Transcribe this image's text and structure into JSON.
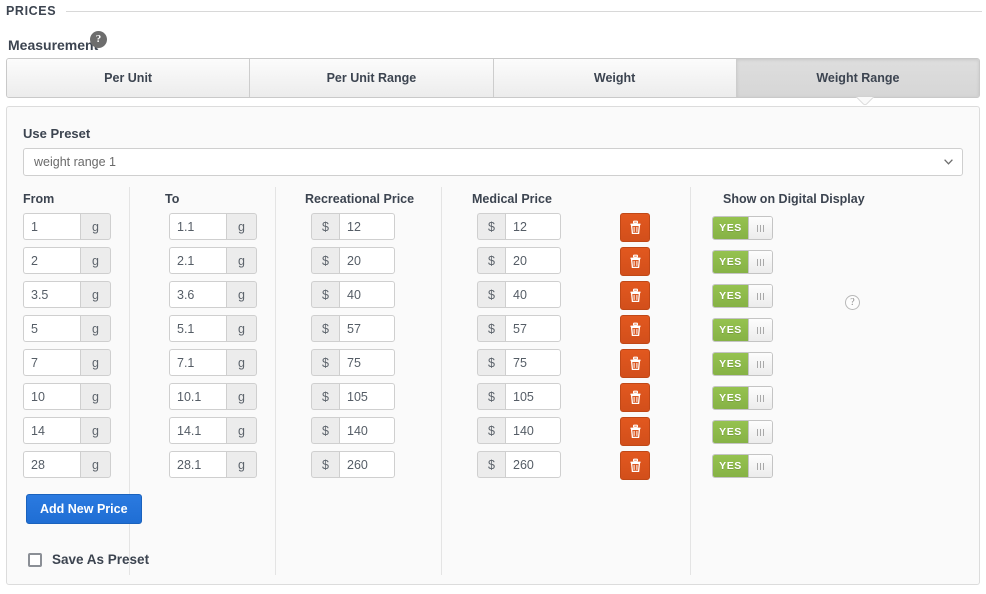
{
  "section": {
    "title": "PRICES"
  },
  "measurement": {
    "label": "Measurement",
    "help_icon": "question-mark-icon",
    "help_glyph": "?"
  },
  "tabs": [
    {
      "label": "Per Unit",
      "active": false
    },
    {
      "label": "Per Unit Range",
      "active": false
    },
    {
      "label": "Weight",
      "active": false
    },
    {
      "label": "Weight Range",
      "active": true
    }
  ],
  "panel": {
    "use_preset_label": "Use Preset",
    "preset_select": {
      "value": "weight range 1",
      "options": [
        "weight range 1"
      ],
      "chevron_icon": "chevron-down-icon"
    },
    "columns": {
      "from": "From",
      "to": "To",
      "recreational": "Recreational Price",
      "medical": "Medical Price",
      "show_on_digital_display": "Show on Digital Display",
      "show_help_glyph": "?"
    },
    "units": {
      "weight_suffix": "g",
      "currency_prefix": "$"
    },
    "toggle": {
      "on_label": "YES",
      "grip_icon": "grip-lines-icon"
    },
    "delete_icon": "trash-icon",
    "rows": [
      {
        "from": "1",
        "to": "1.1",
        "recreational": "12",
        "medical": "12",
        "display": "YES"
      },
      {
        "from": "2",
        "to": "2.1",
        "recreational": "20",
        "medical": "20",
        "display": "YES"
      },
      {
        "from": "3.5",
        "to": "3.6",
        "recreational": "40",
        "medical": "40",
        "display": "YES"
      },
      {
        "from": "5",
        "to": "5.1",
        "recreational": "57",
        "medical": "57",
        "display": "YES"
      },
      {
        "from": "7",
        "to": "7.1",
        "recreational": "75",
        "medical": "75",
        "display": "YES"
      },
      {
        "from": "10",
        "to": "10.1",
        "recreational": "105",
        "medical": "105",
        "display": "YES"
      },
      {
        "from": "14",
        "to": "14.1",
        "recreational": "140",
        "medical": "140",
        "display": "YES"
      },
      {
        "from": "28",
        "to": "28.1",
        "recreational": "260",
        "medical": "260",
        "display": "YES"
      }
    ],
    "add_new_price_label": "Add New Price",
    "save_as_preset_label": "Save As Preset",
    "save_as_preset_checked": false
  },
  "colors": {
    "accent_blue": "#1f6ed4",
    "danger_orange": "#d24f1b",
    "toggle_green": "#86b246",
    "panel_bg": "#fafafa",
    "text": "#3c4450"
  }
}
